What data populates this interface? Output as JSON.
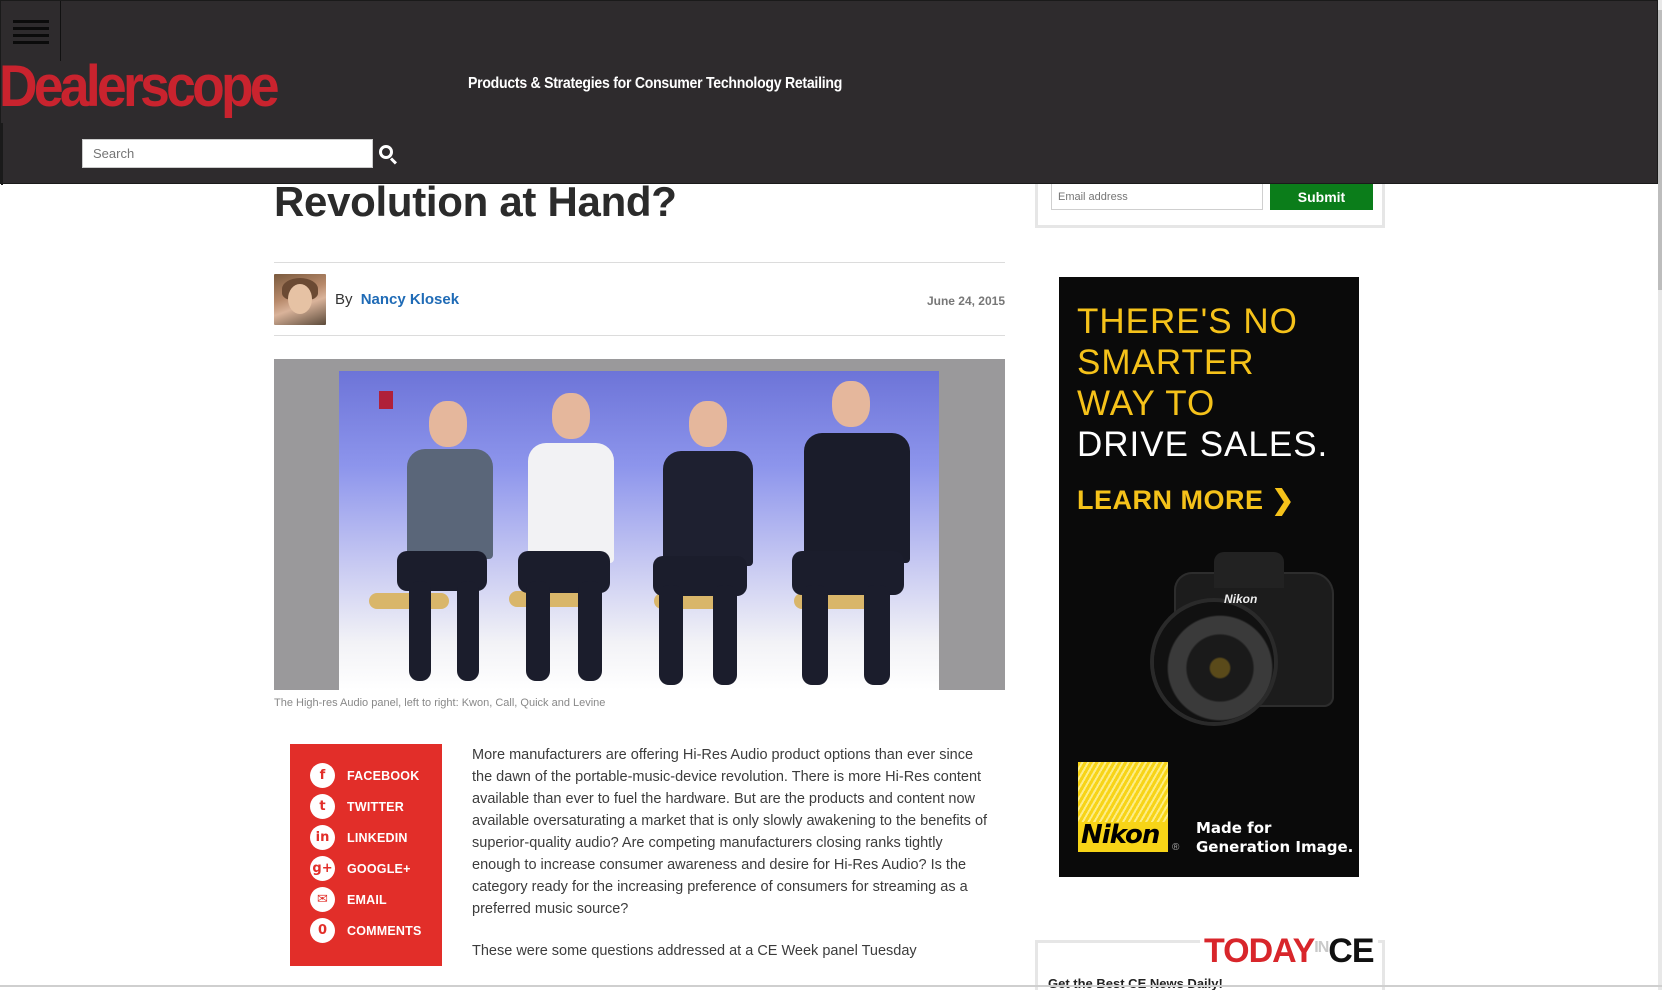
{
  "header": {
    "logo_text": "Dealerscope",
    "tagline": "Products & Strategies for Consumer Technology Retailing",
    "search_placeholder": "Search",
    "menu_icon": "hamburger-icon",
    "search_icon": "search-icon"
  },
  "article": {
    "headline": "Revolution at Hand?",
    "by_prefix": "By",
    "author": "Nancy Klosek",
    "date": "June 24, 2015",
    "caption": "The High-res Audio panel, left to right: Kwon, Call, Quick and Levine",
    "paragraphs": [
      "More manufacturers are offering Hi-Res Audio product options than ever since the dawn of the portable-music-device revolution. There is more Hi-Res content available than ever to fuel the hardware. But are the products and content now available oversaturating a market that is only slowly awakening to the benefits of superior-quality audio? Are competing manufacturers closing ranks tightly enough to increase consumer awareness and desire for Hi-Res Audio? Is the category ready for the increasing preference of consumers for streaming as a preferred music source?",
      "These were some questions addressed at a CE Week panel Tuesday"
    ]
  },
  "share": [
    {
      "icon": "facebook-icon",
      "glyph": "f",
      "label": "FACEBOOK"
    },
    {
      "icon": "twitter-icon",
      "glyph": "t",
      "label": "TWITTER"
    },
    {
      "icon": "linkedin-icon",
      "glyph": "in",
      "label": "LINKEDIN"
    },
    {
      "icon": "googleplus-icon",
      "glyph": "g+",
      "label": "GOOGLE+"
    },
    {
      "icon": "email-icon",
      "glyph": "✉",
      "label": "EMAIL"
    },
    {
      "icon": "comments-icon",
      "glyph": "0",
      "label": "COMMENTS"
    }
  ],
  "newsletter": {
    "email_placeholder": "Email address",
    "submit_label": "Submit"
  },
  "ad": {
    "lines": [
      "THERE'S NO",
      "SMARTER",
      "WAY TO",
      "DRIVE SALES."
    ],
    "cta": "LEARN MORE ❯",
    "camera_brand": "Nikon",
    "logo_text": "Nikon",
    "tagline_line1": "Made for",
    "tagline_line2": "Generation Image.",
    "reg": "®"
  },
  "today_in_ce": {
    "today": "TODAY",
    "in": "IN",
    "ce": "CE",
    "tagline": "Get the Best CE News Daily!"
  },
  "colors": {
    "header_bg": "#2e2b2d",
    "logo_red": "#c9232e",
    "share_red": "#e22e29",
    "link_blue": "#1f6bb6",
    "submit_green": "#0b7d1a",
    "ad_yellow": "#f5c21a"
  }
}
